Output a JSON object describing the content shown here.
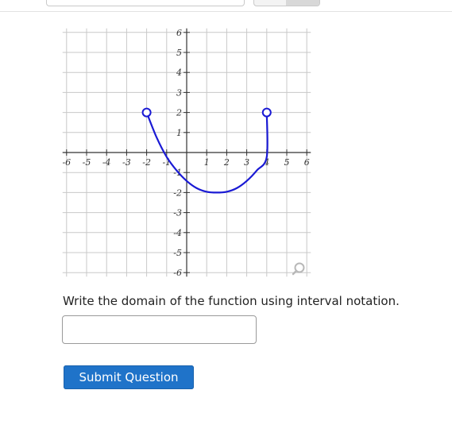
{
  "question": {
    "prompt": "Write the domain of the function using interval notation.",
    "answer_value": "",
    "submit_label": "Submit Question"
  },
  "chart_data": {
    "type": "line",
    "x_ticks": [
      -6,
      -5,
      -4,
      -3,
      -2,
      -1,
      1,
      2,
      3,
      4,
      5,
      6
    ],
    "y_ticks": [
      -6,
      -5,
      -4,
      -3,
      -2,
      -1,
      1,
      2,
      3,
      4,
      5,
      6
    ],
    "xlim": [
      -6,
      6
    ],
    "ylim": [
      -6,
      6
    ],
    "grid": true,
    "series": [
      {
        "color": "#1a1ad4",
        "x": [
          -2,
          -1.5,
          -1,
          -0.5,
          0,
          0.5,
          1,
          1.5,
          2,
          2.5,
          3,
          3.5,
          4
        ],
        "y": [
          2,
          0.75,
          -0.22,
          -0.9,
          -1.42,
          -1.78,
          -1.96,
          -2,
          -1.96,
          -1.78,
          -1.42,
          -0.9,
          -0.22
        ],
        "note_end": {
          "x": 4,
          "y": 2
        }
      }
    ],
    "endpoints": [
      {
        "x": -2,
        "y": 2,
        "open": true
      },
      {
        "x": 4,
        "y": 2,
        "open": true
      }
    ]
  },
  "icons": {
    "zoom": "magnifier-icon"
  }
}
